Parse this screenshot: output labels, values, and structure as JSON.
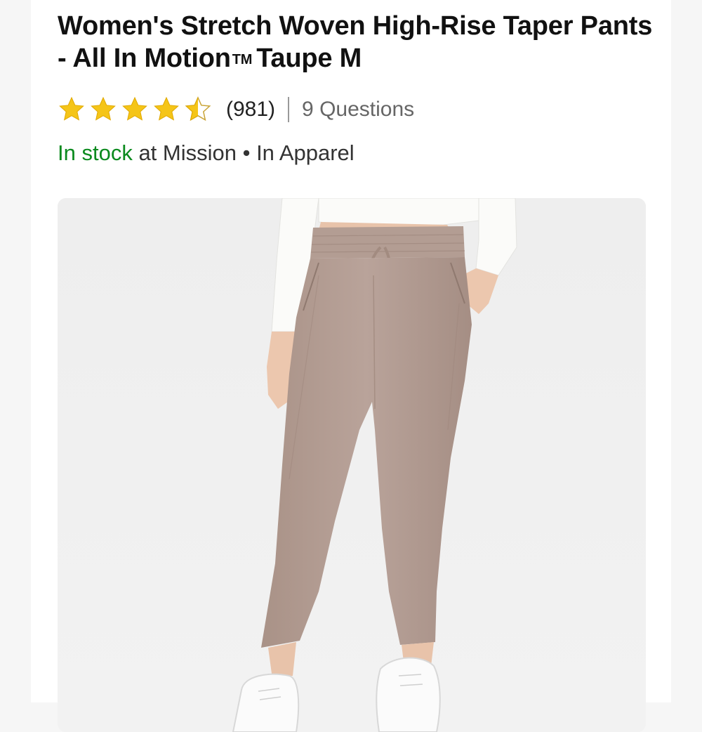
{
  "product": {
    "title_main": "Women's Stretch Woven High-Rise Taper Pants - All In Motion",
    "title_tm": "TM",
    "title_suffix": "Taupe M"
  },
  "rating": {
    "stars": 4.5,
    "review_count": "(981)",
    "questions_label": "9 Questions"
  },
  "availability": {
    "status": "In stock",
    "location_text": " at Mission • In Apparel"
  },
  "colors": {
    "star_fill": "#f5c518",
    "in_stock": "#0b8a1e",
    "pants": "#b39c92"
  },
  "image": {
    "icon": "product-photo"
  }
}
